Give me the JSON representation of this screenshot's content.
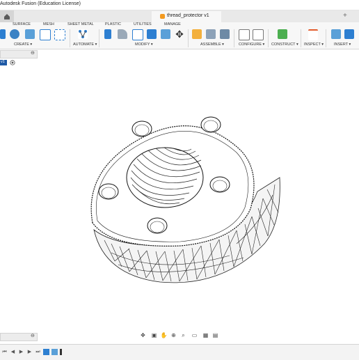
{
  "window": {
    "title": "Autodesk Fusion (Education License)"
  },
  "document_tab": {
    "label": "thread_protector v1",
    "add_tab": "+"
  },
  "workspace_tabs": [
    "SURFACE",
    "MESH",
    "SHEET METAL",
    "PLASTIC",
    "UTILITIES",
    "MANAGE"
  ],
  "ribbon_groups": {
    "create": "CREATE ▾",
    "automate": "AUTOMATE ▾",
    "modify": "MODIFY ▾",
    "assemble": "ASSEMBLE ▾",
    "configure": "CONFIGURE ▾",
    "construct": "CONSTRUCT ▾",
    "inspect": "INSPECT ▾",
    "insert": "INSERT ▾"
  },
  "browser": {
    "close": "⊖",
    "row_label": "v1"
  },
  "colors": {
    "accent_blue": "#1f5aa6",
    "doc_orange": "#f39a1f",
    "ribbon_bg": "#f7f7f7",
    "model_line": "#111111"
  }
}
